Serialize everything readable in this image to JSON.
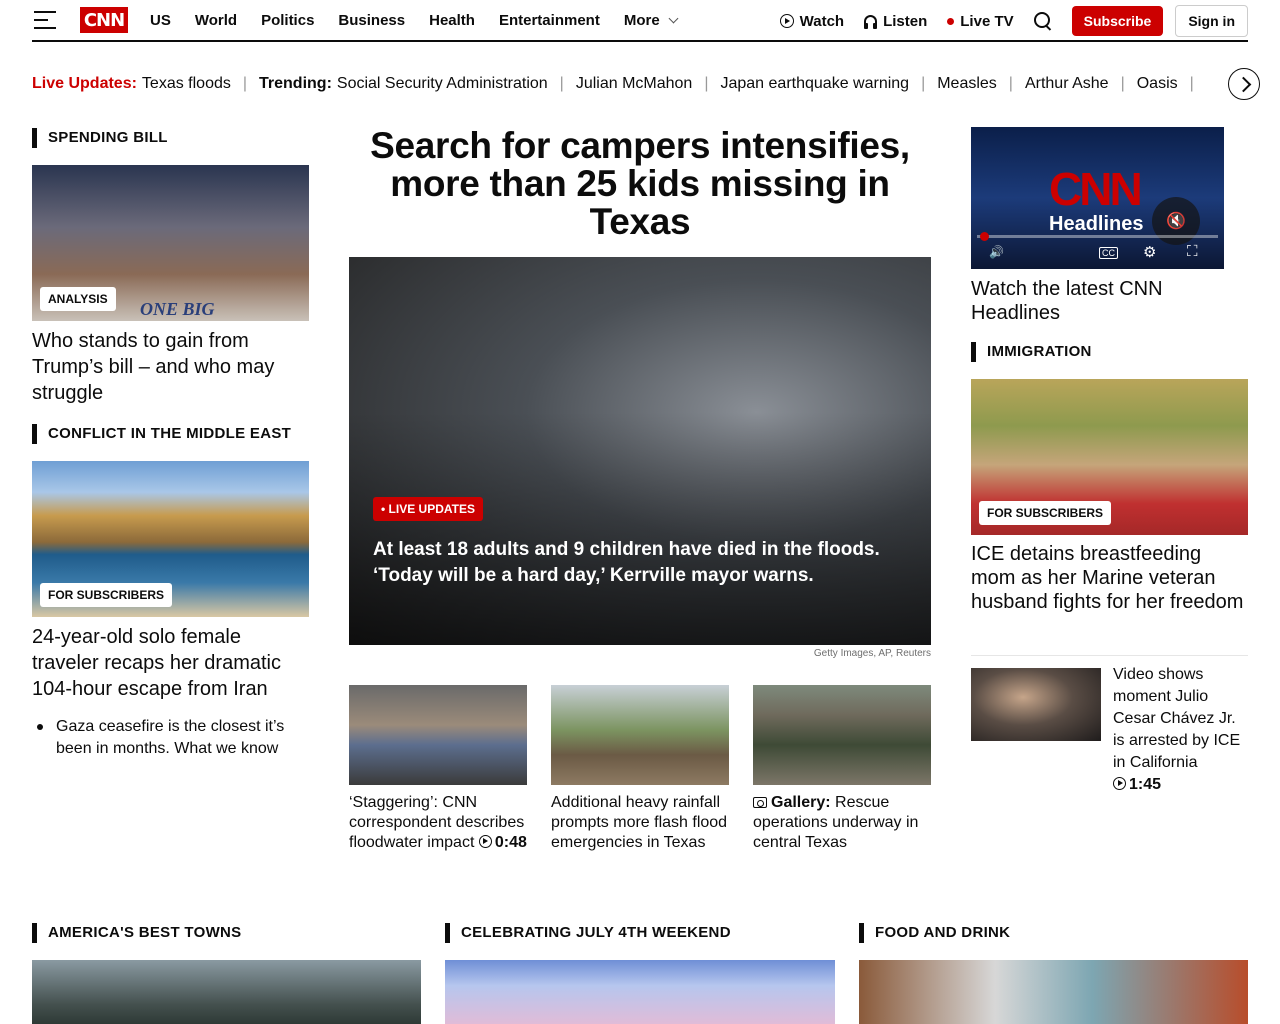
{
  "header": {
    "logo": "CNN",
    "nav": [
      "US",
      "World",
      "Politics",
      "Business",
      "Health",
      "Entertainment"
    ],
    "more_label": "More",
    "watch_label": "Watch",
    "listen_label": "Listen",
    "live_tv_label": "Live TV",
    "subscribe_label": "Subscribe",
    "sign_in_label": "Sign in"
  },
  "ticker": {
    "live_label": "Live Updates:",
    "live_item": "Texas floods",
    "trending_label": "Trending:",
    "items": [
      "Social Security Administration",
      "Julian McMahon",
      "Japan earthquake warning",
      "Measles",
      "Arthur Ashe",
      "Oasis"
    ]
  },
  "left": {
    "section1_label": "SPENDING BILL",
    "card1_badge": "ANALYSIS",
    "card1_headline": "Who stands to gain from Trump’s bill – and who may struggle",
    "card1_image_text": "ONE BIG",
    "section2_label": "CONFLICT IN THE MIDDLE EAST",
    "card2_badge": "FOR SUBSCRIBERS",
    "card2_headline": "24-year-old solo female traveler recaps her dramatic 104-hour escape from Iran",
    "bullet": "Gaza ceasefire is the closest it’s been in months. What we know"
  },
  "center": {
    "main_headline": "Search for campers intensifies, more than 25 kids missing in Texas",
    "live_badge": "• LIVE UPDATES",
    "main_caption": "At least 18 adults and 9 children have died in the floods. ‘Today will be a hard day,’ Kerrville mayor warns.",
    "credit": "Getty Images, AP, Reuters",
    "thumb1_text": "‘Staggering’: CNN correspondent describes floodwater impact",
    "thumb1_duration": "0:48",
    "thumb2_text": "Additional heavy rainfall prompts more flash flood emergencies in Texas",
    "thumb3_prefix": "Gallery:",
    "thumb3_text": "Rescue operations underway in central Texas"
  },
  "right": {
    "video_logo": "CNN",
    "video_logo_sub": "Headlines",
    "video_caption": "Watch the latest CNN Headlines",
    "cc_label": "CC",
    "section_label": "IMMIGRATION",
    "card_badge": "FOR SUBSCRIBERS",
    "card_headline": "ICE detains breastfeeding mom as her Marine veteran husband fights for her freedom",
    "story_text": "Video shows moment Julio Cesar Chávez Jr. is arrested by ICE in California",
    "story_duration": "1:45"
  },
  "bottom": {
    "labels": [
      "AMERICA'S BEST TOWNS",
      "CELEBRATING JULY 4TH WEEKEND",
      "FOOD AND DRINK"
    ]
  },
  "colors": {
    "brand_red": "#cc0000",
    "text": "#0c0c0c"
  }
}
